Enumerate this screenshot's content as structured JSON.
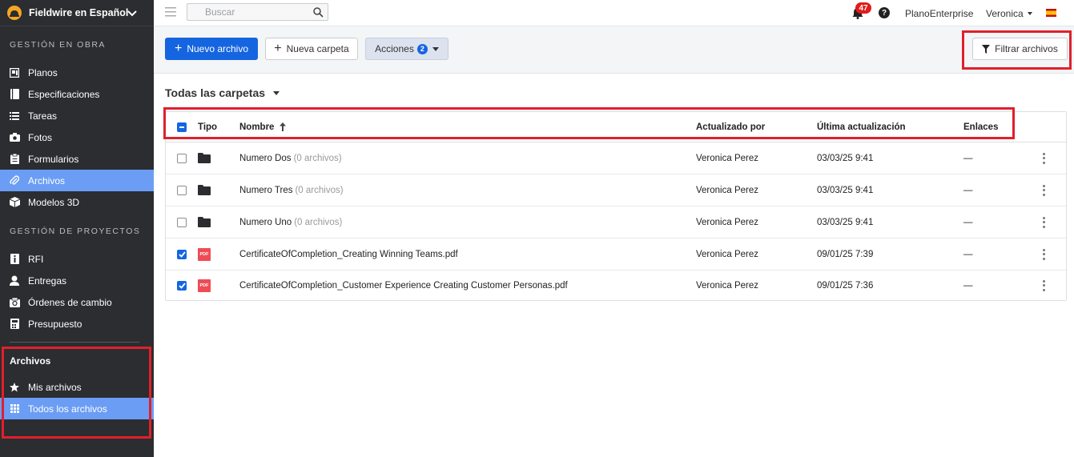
{
  "brand": {
    "name": "Fieldwire en Español",
    "logo_icon": "hardhat-icon"
  },
  "sidebar": {
    "section1_title": "GESTIÓN EN OBRA",
    "section1_items": [
      {
        "label": "Planos",
        "icon": "plans-icon"
      },
      {
        "label": "Especificaciones",
        "icon": "specs-icon"
      },
      {
        "label": "Tareas",
        "icon": "list-icon"
      },
      {
        "label": "Fotos",
        "icon": "camera-icon"
      },
      {
        "label": "Formularios",
        "icon": "clipboard-icon"
      },
      {
        "label": "Archivos",
        "icon": "paperclip-icon",
        "active": true
      },
      {
        "label": "Modelos 3D",
        "icon": "cube-icon"
      }
    ],
    "section2_title": "GESTIÓN DE PROYECTOS",
    "section2_items": [
      {
        "label": "RFI",
        "icon": "rfi-icon"
      },
      {
        "label": "Entregas",
        "icon": "user-icon"
      },
      {
        "label": "Órdenes de cambio",
        "icon": "change-order-icon"
      },
      {
        "label": "Presupuesto",
        "icon": "calculator-icon"
      }
    ],
    "files_title": "Archivos",
    "files_items": [
      {
        "label": "Mis archivos",
        "icon": "star-icon"
      },
      {
        "label": "Todos los archivos",
        "icon": "grid-icon",
        "active": true
      }
    ]
  },
  "topbar": {
    "search_placeholder": "Buscar",
    "notifications_count": "47",
    "help_label": "?",
    "org_name": "PlanoEnterprise",
    "user_name": "Veronica"
  },
  "toolbar": {
    "new_file_label": "Nuevo archivo",
    "new_folder_label": "Nueva carpeta",
    "actions_label": "Acciones",
    "actions_count": "2",
    "filter_label": "Filtrar archivos"
  },
  "content": {
    "folder_title": "Todas las carpetas",
    "columns": {
      "type": "Tipo",
      "name": "Nombre",
      "updated_by": "Actualizado por",
      "last_update": "Última actualización",
      "links": "Enlaces"
    },
    "rows": [
      {
        "type": "folder",
        "name": "Numero Dos",
        "meta": "(0 archivos)",
        "updated_by": "Veronica Perez",
        "date": "03/03/25 9:41",
        "links": "—",
        "checked": false
      },
      {
        "type": "folder",
        "name": "Numero Tres",
        "meta": "(0 archivos)",
        "updated_by": "Veronica Perez",
        "date": "03/03/25 9:41",
        "links": "—",
        "checked": false
      },
      {
        "type": "folder",
        "name": "Numero Uno",
        "meta": "(0 archivos)",
        "updated_by": "Veronica Perez",
        "date": "03/03/25 9:41",
        "links": "—",
        "checked": false
      },
      {
        "type": "pdf",
        "name": "CertificateOfCompletion_Creating Winning Teams.pdf",
        "meta": "",
        "updated_by": "Veronica Perez",
        "date": "09/01/25 7:39",
        "links": "—",
        "checked": true
      },
      {
        "type": "pdf",
        "name": "CertificateOfCompletion_Customer Experience Creating Customer Personas.pdf",
        "meta": "",
        "updated_by": "Veronica Perez",
        "date": "09/01/25 7:36",
        "links": "—",
        "checked": true
      }
    ],
    "pdf_label": "PDF"
  },
  "colors": {
    "primary": "#1565e0",
    "sidebar_bg": "#2b2d30",
    "sidebar_active": "#6b9df5",
    "highlight": "#e0202c",
    "badge": "#e21b1b",
    "pdf": "#ef4b55"
  }
}
